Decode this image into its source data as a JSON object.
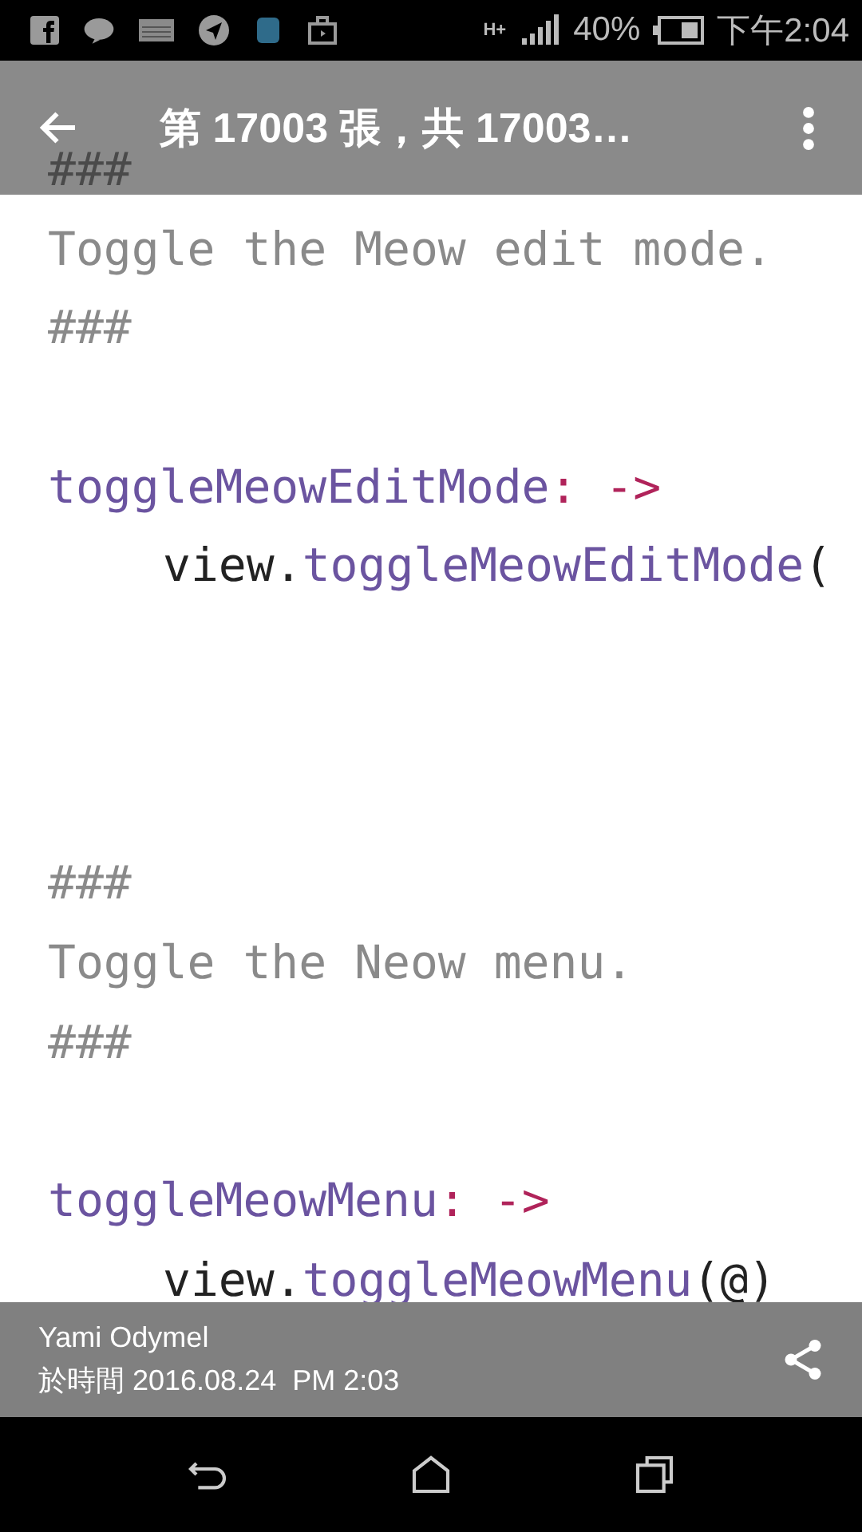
{
  "status_bar": {
    "network": "H+",
    "battery_percent": "40%",
    "time": "下午2:04"
  },
  "app_bar": {
    "title": "第 17003 張，共 17003…"
  },
  "code_lines": [
    {
      "kind": "code",
      "indent": false,
      "segments": [
        {
          "kind": "comment",
          "text": "###"
        }
      ]
    },
    {
      "kind": "code",
      "indent": false,
      "segments": [
        {
          "kind": "comment",
          "text": "Toggle the Meow edit mode."
        }
      ]
    },
    {
      "kind": "code",
      "indent": false,
      "segments": [
        {
          "kind": "comment",
          "text": "###"
        }
      ]
    },
    {
      "kind": "blank"
    },
    {
      "kind": "code",
      "indent": false,
      "segments": [
        {
          "kind": "function",
          "text": "toggleMeowEditMode"
        },
        {
          "kind": "keyword",
          "text": ": ->"
        }
      ]
    },
    {
      "kind": "code",
      "indent": true,
      "segments": [
        {
          "kind": "plain",
          "text": "view."
        },
        {
          "kind": "function",
          "text": "toggleMeowEditMode"
        },
        {
          "kind": "plain",
          "text": "("
        }
      ]
    },
    {
      "kind": "blank"
    },
    {
      "kind": "blank"
    },
    {
      "kind": "blank"
    },
    {
      "kind": "code",
      "indent": false,
      "segments": [
        {
          "kind": "comment",
          "text": "###"
        }
      ]
    },
    {
      "kind": "code",
      "indent": false,
      "segments": [
        {
          "kind": "comment",
          "text": "Toggle the Neow menu."
        }
      ]
    },
    {
      "kind": "code",
      "indent": false,
      "segments": [
        {
          "kind": "comment",
          "text": "###"
        }
      ]
    },
    {
      "kind": "blank"
    },
    {
      "kind": "code",
      "indent": false,
      "segments": [
        {
          "kind": "function",
          "text": "toggleMeowMenu"
        },
        {
          "kind": "keyword",
          "text": ": ->"
        }
      ]
    },
    {
      "kind": "code",
      "indent": true,
      "segments": [
        {
          "kind": "plain",
          "text": "view."
        },
        {
          "kind": "function",
          "text": "toggleMeowMenu"
        },
        {
          "kind": "plain",
          "text": "(@)"
        }
      ]
    }
  ],
  "info_bar": {
    "author": "Yami Odymel",
    "timestamp": "於時間 2016.08.24  PM 2:03"
  }
}
